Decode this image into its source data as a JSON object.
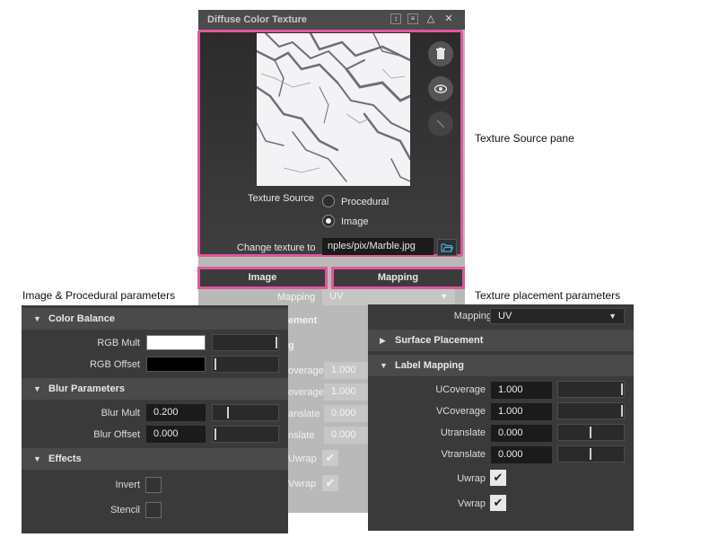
{
  "window": {
    "title": "Diffuse Color Texture",
    "icons": [
      "updown-icon",
      "list-icon",
      "triangle-icon",
      "close-icon"
    ]
  },
  "source_pane": {
    "side_buttons": [
      "trash-icon",
      "eye-icon",
      "pen-icon"
    ],
    "texture_source_label": "Texture Source",
    "options": [
      "Procedural",
      "Image"
    ],
    "selected": "Image",
    "change_texture_label": "Change texture to",
    "path_value": "nples/pix/Marble.jpg",
    "folder_icon": "folder-open-icon"
  },
  "tabs": {
    "image": "Image",
    "mapping": "Mapping"
  },
  "callouts": {
    "texture_source": "Texture Source pane",
    "image_procedural": "Image & Procedural parameters",
    "placement": "Texture placement parameters"
  },
  "faded": {
    "mapping_label": "Mapping",
    "mapping_value": "UV",
    "frag_section1": "ement",
    "frag_section2": "g",
    "frag_ucov": "overage",
    "frag_vcov": "overage",
    "frag_utrans": "anslate",
    "frag_vtrans": "nslate",
    "val_ucov": "1.000",
    "val_vcov": "1.000",
    "val_utrans": "0.000",
    "val_vtrans": "0.000",
    "frag_uwrap": "Uwrap",
    "frag_vwrap": "Vwrap"
  },
  "left_panel": {
    "color_balance": "Color Balance",
    "rgb_mult": "RGB Mult",
    "rgb_offset": "RGB Offset",
    "rgb_mult_color": "#ffffff",
    "rgb_offset_color": "#000000",
    "rgb_mult_level": 1.0,
    "rgb_offset_level": 0.0,
    "blur_parameters": "Blur Parameters",
    "blur_mult": "Blur Mult",
    "blur_mult_value": "0.200",
    "blur_offset": "Blur Offset",
    "blur_offset_value": "0.000",
    "effects": "Effects",
    "invert": "Invert",
    "stencil": "Stencil"
  },
  "right_panel": {
    "mapping_label": "Mapping",
    "mapping_value": "UV",
    "surface_placement": "Surface Placement",
    "label_mapping": "Label Mapping",
    "ucoverage": "UCoverage",
    "ucoverage_value": "1.000",
    "vcoverage": "VCoverage",
    "vcoverage_value": "1.000",
    "utranslate": "Utranslate",
    "utranslate_value": "0.000",
    "vtranslate": "Vtranslate",
    "vtranslate_value": "0.000",
    "uwrap": "Uwrap",
    "vwrap": "Vwrap"
  },
  "colors": {
    "highlight": "#e0569c",
    "panel": "#3a3a3a",
    "header": "#4a4a4a"
  }
}
